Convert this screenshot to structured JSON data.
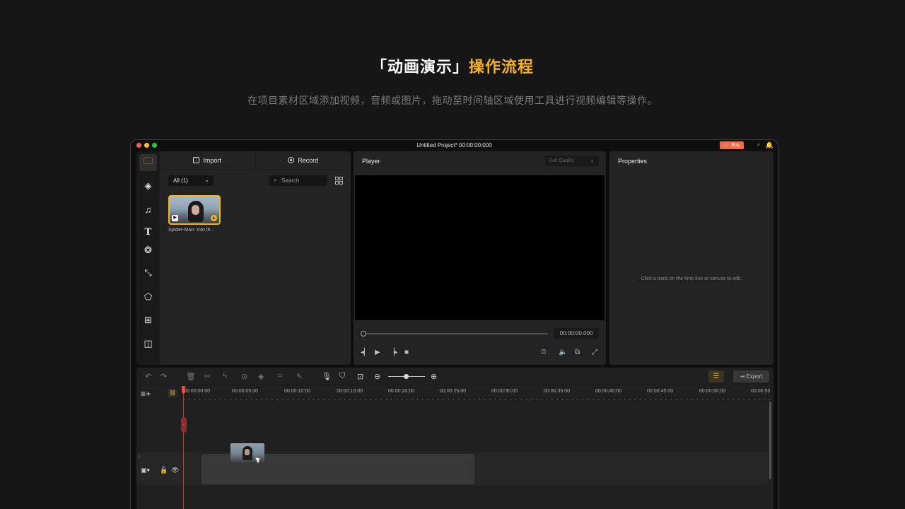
{
  "headline": {
    "part1": "「动画演示」",
    "part2": "操作流程"
  },
  "subline": "在项目素材区域添加视频，音频或图片，拖动至时间轴区域使用工具进行视频编辑等操作。",
  "window": {
    "title": "Untitled Project*  00:00:00:000",
    "buy_label": "Buy"
  },
  "media": {
    "import_label": "Import",
    "record_label": "Record",
    "filter_value": "All (1)",
    "search_placeholder": "Search",
    "clip_label": "Spider-Man: Into th..."
  },
  "sidebar_icons": [
    "folder-icon",
    "layers-icon",
    "music-icon",
    "text-icon",
    "filters-icon",
    "transitions-icon",
    "stickers-icon",
    "add-media-icon",
    "layout-icon"
  ],
  "player": {
    "title": "Player",
    "quality": "Full Quality",
    "timecode": "00:00:00.000"
  },
  "properties": {
    "title": "Properties",
    "hint": "Click a track on the time line or canvas to edit."
  },
  "timeline": {
    "export_label": "Export",
    "ruler": [
      "00:00:00:00",
      "00:00:05:00",
      "00:00:10:00",
      "00:00:15:00",
      "00:00:20:00",
      "00:00:25:00",
      "00:00:30:00",
      "00:00:35:00",
      "00:00:40:00",
      "00:00:45:00",
      "00:00:50:00",
      "00:00:55"
    ],
    "track_number": "1"
  },
  "colors": {
    "accent": "#f5b323",
    "buy": "#ff6a45",
    "playhead": "#c0392b"
  }
}
